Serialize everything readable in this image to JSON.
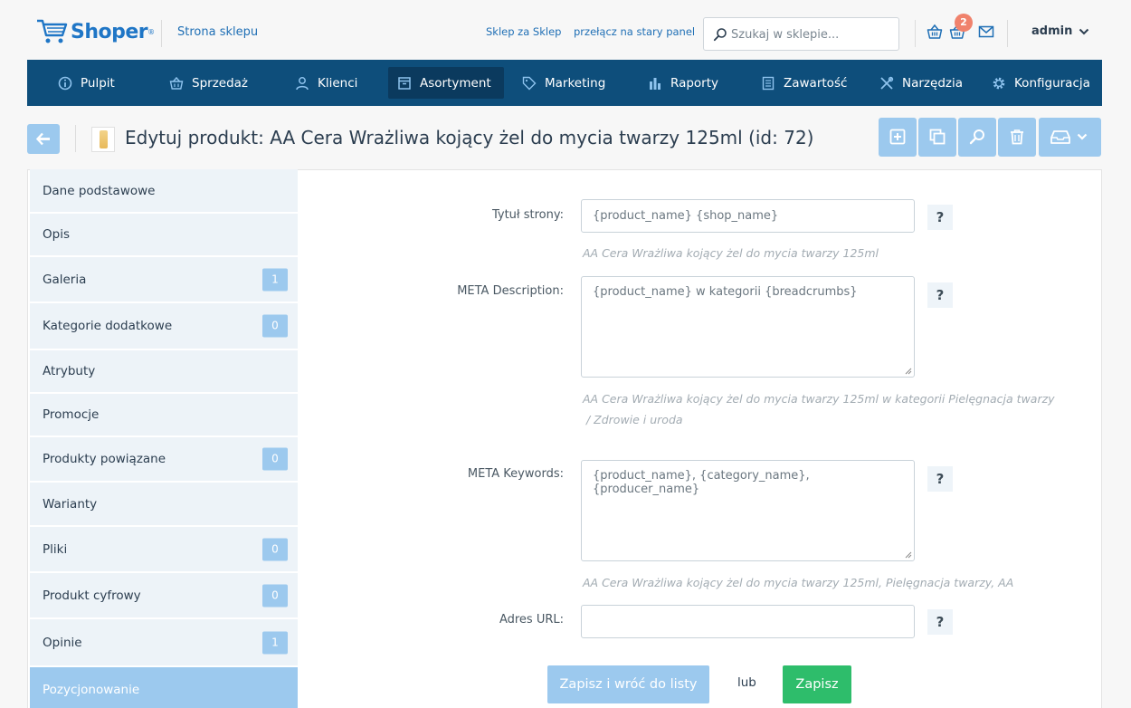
{
  "header": {
    "brand": "Shoper",
    "brand_mark": "®",
    "shop_link": "Strona sklepu",
    "links": [
      "Sklep za Sklep",
      "przełącz na stary panel"
    ],
    "search_placeholder": "Szukaj w sklepie...",
    "cart_badge": "2",
    "user": "admin"
  },
  "nav": {
    "items": [
      {
        "label": "Pulpit",
        "icon": "info-icon"
      },
      {
        "label": "Sprzedaż",
        "icon": "basket-icon"
      },
      {
        "label": "Klienci",
        "icon": "users-icon"
      },
      {
        "label": "Asortyment",
        "icon": "box-icon",
        "active": true
      },
      {
        "label": "Marketing",
        "icon": "tag-icon"
      },
      {
        "label": "Raporty",
        "icon": "chart-icon"
      },
      {
        "label": "Zawartość",
        "icon": "document-icon"
      },
      {
        "label": "Narzędzia",
        "icon": "tools-icon"
      },
      {
        "label": "Konfiguracja",
        "icon": "gear-icon"
      }
    ]
  },
  "page": {
    "title": "Edytuj produkt: AA Cera Wrażliwa kojący żel do mycia twarzy 125ml (id: 72)"
  },
  "sidebar": {
    "items": [
      {
        "label": "Dane podstawowe"
      },
      {
        "label": "Opis"
      },
      {
        "label": "Galeria",
        "count": "1"
      },
      {
        "label": "Kategorie dodatkowe",
        "count": "0"
      },
      {
        "label": "Atrybuty"
      },
      {
        "label": "Promocje"
      },
      {
        "label": "Produkty powiązane",
        "count": "0"
      },
      {
        "label": "Warianty"
      },
      {
        "label": "Pliki",
        "count": "0"
      },
      {
        "label": "Produkt cyfrowy",
        "count": "0"
      },
      {
        "label": "Opinie",
        "count": "1"
      },
      {
        "label": "Pozycjonowanie",
        "active": true
      }
    ]
  },
  "form": {
    "page_title": {
      "label": "Tytuł strony:",
      "placeholder": "{product_name} {shop_name}",
      "hint": "AA Cera Wrażliwa kojący żel do mycia twarzy 125ml"
    },
    "meta_description": {
      "label": "META Description:",
      "placeholder": "{product_name} w kategorii {breadcrumbs}",
      "hint_line1": "AA Cera Wrażliwa kojący żel do mycia twarzy 125ml w kategorii Pielęgnacja twarzy",
      "hint_line2": " / Zdrowie i uroda"
    },
    "meta_keywords": {
      "label": "META Keywords:",
      "placeholder": "{product_name}, {category_name}, {producer_name}",
      "hint": "AA Cera Wrażliwa kojący żel do mycia twarzy 125ml, Pielęgnacja twarzy, AA"
    },
    "url": {
      "label": "Adres URL:",
      "value": ""
    },
    "help": "?",
    "save_back": "Zapisz i wróć do listy",
    "or": "lub",
    "save": "Zapisz"
  },
  "colors": {
    "nav_bg": "#0e4e7b",
    "accent_light": "#9cc9ee",
    "save_green": "#2ebd6b",
    "badge_red": "#f0826c"
  }
}
